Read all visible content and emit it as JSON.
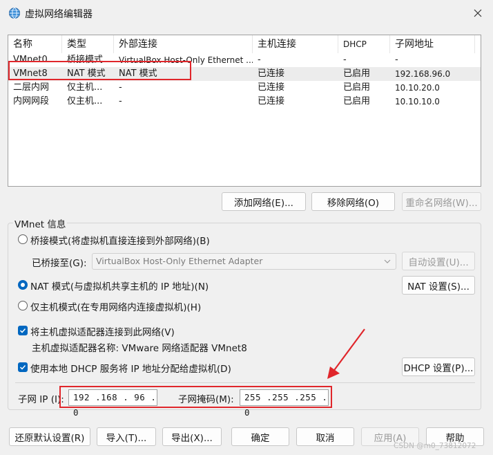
{
  "window": {
    "title": "虚拟网络编辑器"
  },
  "columns": [
    "名称",
    "类型",
    "外部连接",
    "主机连接",
    "DHCP",
    "子网地址"
  ],
  "rows": [
    [
      "VMnet0",
      "桥接模式",
      "VirtualBox Host-Only Ethernet ...",
      "-",
      "-",
      "-"
    ],
    [
      "VMnet8",
      "NAT 模式",
      "NAT 模式",
      "已连接",
      "已启用",
      "192.168.96.0"
    ],
    [
      "二层内网",
      "仅主机...",
      "-",
      "已连接",
      "已启用",
      "10.10.20.0"
    ],
    [
      "内网网段",
      "仅主机...",
      "-",
      "已连接",
      "已启用",
      "10.10.10.0"
    ]
  ],
  "list_buttons": {
    "add": "添加网络(E)...",
    "remove": "移除网络(O)",
    "rename": "重命名网络(W)..."
  },
  "vmnet_info": {
    "title": "VMnet 信息",
    "bridged_label": "桥接模式(将虚拟机直接连接到外部网络)(B)",
    "bridged_to_label": "已桥接至(G):",
    "bridged_to_value": "VirtualBox Host-Only Ethernet Adapter",
    "auto_settings": "自动设置(U)...",
    "nat_label": "NAT 模式(与虚拟机共享主机的 IP 地址)(N)",
    "nat_settings": "NAT 设置(S)...",
    "hostonly_label": "仅主机模式(在专用网络内连接虚拟机)(H)",
    "connect_adapter_label": "将主机虚拟适配器连接到此网络(V)",
    "adapter_name": "主机虚拟适配器名称: VMware 网络适配器 VMnet8",
    "dhcp_label": "使用本地 DHCP 服务将 IP 地址分配给虚拟机(D)",
    "dhcp_settings": "DHCP 设置(P)..."
  },
  "subnet": {
    "ip_label": "子网 IP (I):",
    "ip_value": "192 .168 . 96 . 0",
    "mask_label": "子网掩码(M):",
    "mask_value": "255 .255 .255 . 0"
  },
  "footer": {
    "restore": "还原默认设置(R)",
    "import": "导入(T)...",
    "export": "导出(X)...",
    "ok": "确定",
    "cancel": "取消",
    "apply": "应用(A)",
    "help": "帮助"
  },
  "watermark": "CSDN @m0_73812072",
  "colors": {
    "accent": "#0067c0",
    "highlight": "#e0262b"
  }
}
